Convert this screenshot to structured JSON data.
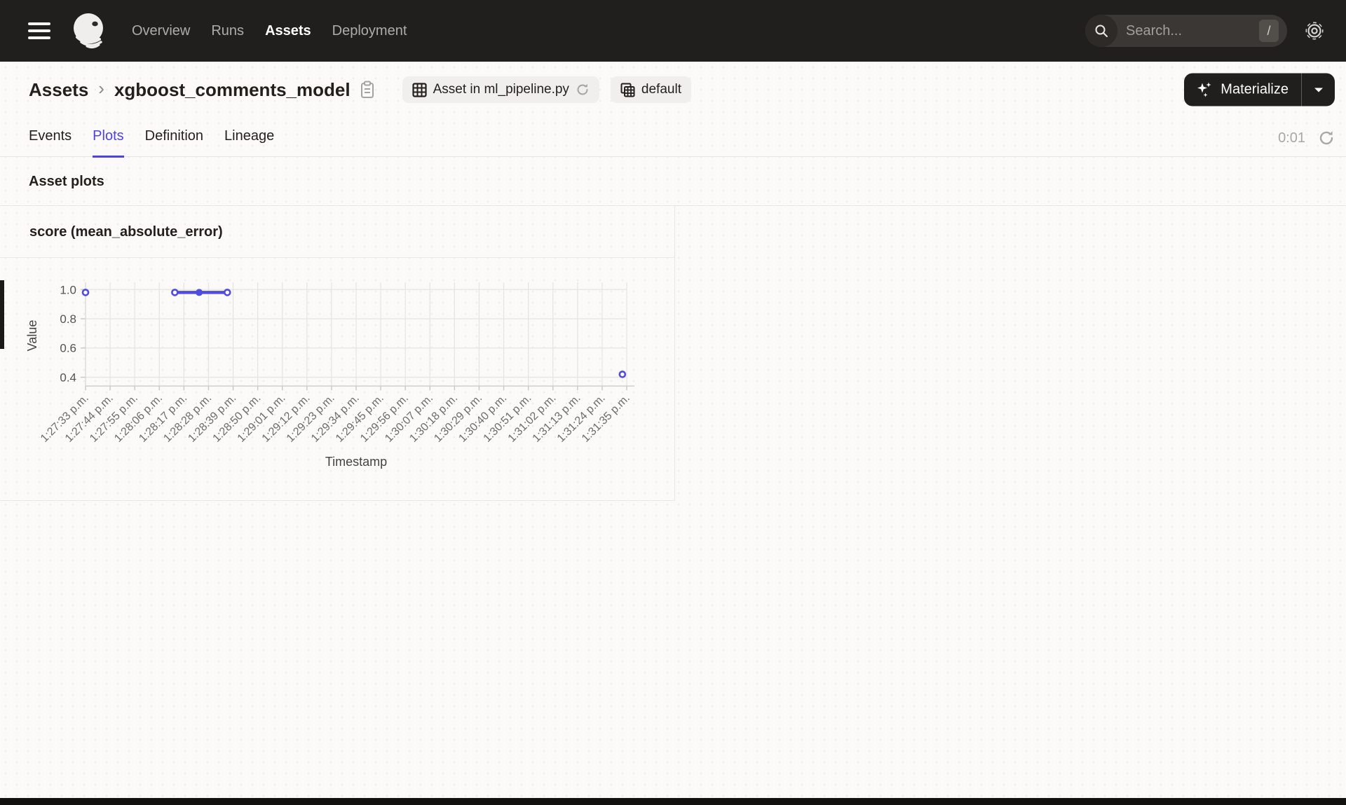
{
  "app": {
    "name": "Dagster"
  },
  "colors": {
    "accent": "#4F43DD",
    "nav_bg": "#211F1E",
    "chart_line": "#524BE0"
  },
  "nav": {
    "items": [
      {
        "label": "Overview",
        "active": false
      },
      {
        "label": "Runs",
        "active": false
      },
      {
        "label": "Assets",
        "active": true
      },
      {
        "label": "Deployment",
        "active": false
      }
    ],
    "search": {
      "placeholder": "Search...",
      "shortcut": "/"
    }
  },
  "header": {
    "breadcrumb": {
      "root": "Assets",
      "separator": "›",
      "current": "xgboost_comments_model"
    },
    "chips": [
      {
        "label": "Asset in ml_pipeline.py",
        "has_refresh": true
      },
      {
        "label": "default",
        "has_refresh": false
      }
    ],
    "materialize_label": "Materialize"
  },
  "tabs": {
    "items": [
      {
        "label": "Events",
        "active": false
      },
      {
        "label": "Plots",
        "active": true
      },
      {
        "label": "Definition",
        "active": false
      },
      {
        "label": "Lineage",
        "active": false
      }
    ],
    "timer": "0:01"
  },
  "section_title": "Asset plots",
  "chart_data": {
    "type": "line",
    "title": "score (mean_absolute_error)",
    "xlabel": "Timestamp",
    "ylabel": "Value",
    "grid": true,
    "legend": "none",
    "yticks": [
      1.0,
      0.8,
      0.6,
      0.4
    ],
    "ylim": [
      0.34,
      1.03
    ],
    "xticklabels": [
      "1:27:33 p.m.",
      "1:27:44 p.m.",
      "1:27:55 p.m.",
      "1:28:06 p.m.",
      "1:28:17 p.m.",
      "1:28:28 p.m.",
      "1:28:39 p.m.",
      "1:28:50 p.m.",
      "1:29:01 p.m.",
      "1:29:12 p.m.",
      "1:29:23 p.m.",
      "1:29:34 p.m.",
      "1:29:45 p.m.",
      "1:29:56 p.m.",
      "1:30:07 p.m.",
      "1:30:18 p.m.",
      "1:30:29 p.m.",
      "1:30:40 p.m.",
      "1:30:51 p.m.",
      "1:31:02 p.m.",
      "1:31:13 p.m.",
      "1:31:24 p.m.",
      "1:31:35 p.m."
    ],
    "series": [
      {
        "name": "score (mean_absolute_error)",
        "color": "#524BE0",
        "points": [
          {
            "x_frac": 0.0,
            "value": 0.98,
            "marker": "ring"
          },
          {
            "x_frac": 0.165,
            "value": 0.98,
            "marker": "ring"
          },
          {
            "x_frac": 0.21,
            "value": 0.98,
            "marker": "dot"
          },
          {
            "x_frac": 0.262,
            "value": 0.98,
            "marker": "ring"
          },
          {
            "x_frac": 0.992,
            "value": 0.42,
            "marker": "ring"
          }
        ],
        "segments": [
          [
            1,
            2,
            3
          ]
        ]
      }
    ]
  }
}
